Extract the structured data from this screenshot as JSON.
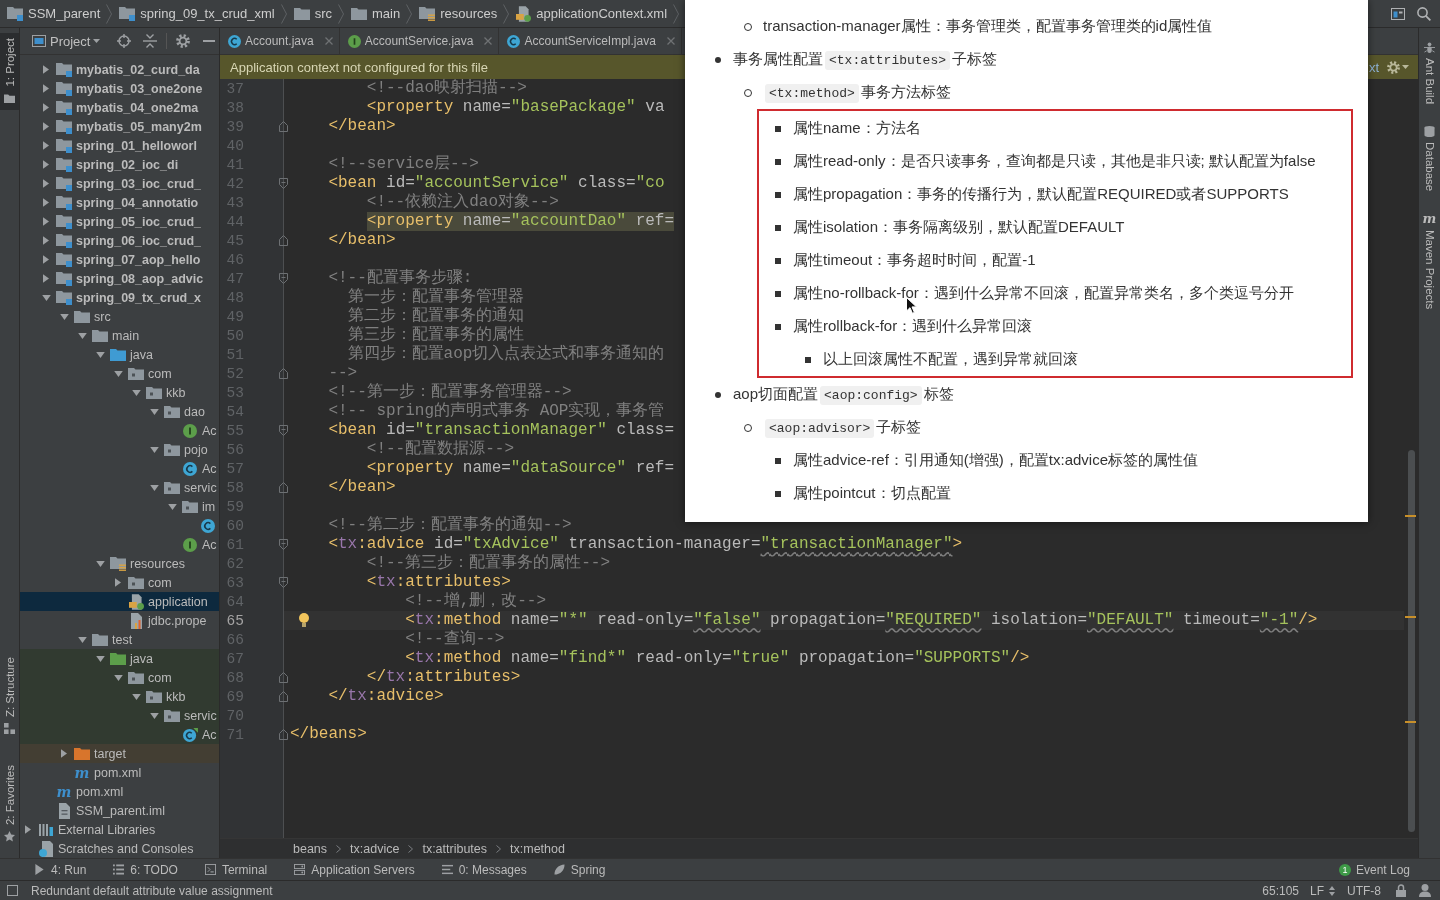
{
  "nav_bar": {
    "crumbs": [
      {
        "kind": "module",
        "label": "SSM_parent"
      },
      {
        "kind": "module",
        "label": "spring_09_tx_crud_xml"
      },
      {
        "kind": "folder",
        "label": "src"
      },
      {
        "kind": "folder",
        "label": "main"
      },
      {
        "kind": "resources-root",
        "label": "resources"
      },
      {
        "kind": "spring-xml",
        "label": "applicationContext.xml"
      }
    ]
  },
  "left_stripe": {
    "top": [
      {
        "kind": "project",
        "label": "1: Project",
        "selected": true
      }
    ],
    "bottom": [
      {
        "kind": "structure",
        "label": "Z: Structure",
        "selected": false
      },
      {
        "kind": "favorites",
        "label": "2: Favorites",
        "selected": false
      }
    ]
  },
  "project_panel": {
    "title": "Project",
    "tree": [
      {
        "kind": "module",
        "label": "mybatis_02_curd_da",
        "expanded": false,
        "selected": false
      },
      {
        "kind": "module",
        "label": "mybatis_03_one2one",
        "expanded": false,
        "selected": false
      },
      {
        "kind": "module",
        "label": "mybatis_04_one2ma",
        "expanded": false,
        "selected": false
      },
      {
        "kind": "module",
        "label": "mybatis_05_many2m",
        "expanded": false,
        "selected": false
      },
      {
        "kind": "module",
        "label": "spring_01_helloworl",
        "expanded": false,
        "selected": false
      },
      {
        "kind": "module",
        "label": "spring_02_ioc_di",
        "expanded": false,
        "selected": false
      },
      {
        "kind": "module",
        "label": "spring_03_ioc_crud_",
        "expanded": false,
        "selected": false
      },
      {
        "kind": "module",
        "label": "spring_04_annotatio",
        "expanded": false,
        "selected": false
      },
      {
        "kind": "module",
        "label": "spring_05_ioc_crud_",
        "expanded": false,
        "selected": false
      },
      {
        "kind": "module",
        "label": "spring_06_ioc_crud_",
        "expanded": false,
        "selected": false
      },
      {
        "kind": "module",
        "label": "spring_07_aop_hello",
        "expanded": false,
        "selected": false
      },
      {
        "kind": "module",
        "label": "spring_08_aop_advic",
        "expanded": false,
        "selected": false
      },
      {
        "kind": "module",
        "label": "spring_09_tx_crud_x",
        "expanded": true,
        "selected": false,
        "children": [
          {
            "kind": "folder",
            "label": "src",
            "expanded": true,
            "selected": false,
            "children": [
              {
                "kind": "folder",
                "label": "main",
                "expanded": true,
                "selected": false,
                "children": [
                  {
                    "kind": "source-root",
                    "label": "java",
                    "expanded": true,
                    "selected": false,
                    "children": [
                      {
                        "kind": "package",
                        "label": "com",
                        "expanded": true,
                        "selected": false,
                        "children": [
                          {
                            "kind": "package",
                            "label": "kkb",
                            "expanded": true,
                            "selected": false,
                            "children": [
                              {
                                "kind": "package",
                                "label": "dao",
                                "expanded": true,
                                "selected": false,
                                "children": [
                                  {
                                    "kind": "interface",
                                    "label": "Ac",
                                    "selected": false
                                  }
                                ]
                              },
                              {
                                "kind": "package",
                                "label": "pojo",
                                "expanded": true,
                                "selected": false,
                                "children": [
                                  {
                                    "kind": "class",
                                    "label": "Ac",
                                    "selected": false
                                  }
                                ]
                              },
                              {
                                "kind": "package",
                                "label": "servic",
                                "expanded": true,
                                "selected": false,
                                "children": [
                                  {
                                    "kind": "package",
                                    "label": "im",
                                    "expanded": true,
                                    "selected": false,
                                    "children": [
                                      {
                                        "kind": "class",
                                        "selected": false
                                      }
                                    ]
                                  },
                                  {
                                    "kind": "interface",
                                    "label": "Ac",
                                    "selected": false
                                  }
                                ]
                              }
                            ]
                          }
                        ]
                      }
                    ]
                  },
                  {
                    "kind": "resources-root",
                    "label": "resources",
                    "expanded": true,
                    "selected": false,
                    "children": [
                      {
                        "kind": "package",
                        "label": "com",
                        "expanded": false,
                        "selected": false
                      },
                      {
                        "kind": "spring-xml",
                        "label": "application",
                        "selected": true
                      },
                      {
                        "kind": "properties",
                        "label": "jdbc.prope",
                        "selected": false
                      }
                    ]
                  }
                ]
              },
              {
                "kind": "folder",
                "label": "test",
                "expanded": true,
                "selected": false,
                "children": [
                  {
                    "kind": "test-root",
                    "label": "java",
                    "expanded": true,
                    "selected": false,
                    "children": [
                      {
                        "kind": "package",
                        "label": "com",
                        "expanded": true,
                        "selected": false,
                        "children": [
                          {
                            "kind": "package",
                            "label": "kkb",
                            "expanded": true,
                            "selected": false,
                            "children": [
                              {
                                "kind": "package",
                                "label": "servic",
                                "expanded": true,
                                "selected": false,
                                "children": [
                                  {
                                    "kind": "test-class",
                                    "label": "Ac",
                                    "selected": false
                                  }
                                ]
                              }
                            ]
                          }
                        ]
                      }
                    ]
                  }
                ]
              }
            ]
          },
          {
            "kind": "excluded-folder",
            "label": "target",
            "expanded": false,
            "selected": false
          },
          {
            "kind": "maven-file",
            "icon_text": "m",
            "label": "pom.xml",
            "selected": false
          }
        ]
      },
      {
        "kind": "maven-file",
        "icon_text": "m",
        "label": "pom.xml",
        "selected": false
      },
      {
        "kind": "iml-file",
        "label": "SSM_parent.iml",
        "selected": false
      }
    ],
    "root_items": [
      {
        "kind": "libraries",
        "label": "External Libraries",
        "expanded": false,
        "selected": false
      },
      {
        "kind": "scratches",
        "label": "Scratches and Consoles",
        "selected": false
      }
    ]
  },
  "editor": {
    "tabs": [
      {
        "kind": "class",
        "label": "Account.java",
        "selected": false
      },
      {
        "kind": "interface",
        "label": "AccountService.java",
        "selected": false
      },
      {
        "kind": "class",
        "label": "AccountServiceImpl.java",
        "selected": false
      }
    ],
    "banner": {
      "message": "Application context not configured for this file",
      "link": "xt"
    },
    "lines": [
      {
        "no": "37",
        "kind": "plain",
        "tokens": [
          {
            "kind": "comment",
            "text": "        <!--dao映射扫描-->"
          }
        ],
        "current": false,
        "highlighted": false
      },
      {
        "no": "38",
        "kind": "plain",
        "tokens": [
          {
            "kind": "tag",
            "text": "        <property"
          },
          {
            "kind": "attr",
            "text": " name="
          },
          {
            "kind": "value",
            "text": "\"basePackage\""
          },
          {
            "kind": "attr",
            "text": " va"
          }
        ],
        "current": false,
        "highlighted": false
      },
      {
        "no": "39",
        "kind": "closer",
        "tokens": [
          {
            "kind": "tag",
            "text": "    </bean>"
          }
        ],
        "current": false,
        "highlighted": false
      },
      {
        "no": "40",
        "kind": "plain",
        "current": false
      },
      {
        "no": "41",
        "kind": "plain",
        "tokens": [
          {
            "kind": "comment",
            "text": "    <!--service层-->"
          }
        ],
        "current": false,
        "highlighted": false
      },
      {
        "no": "42",
        "kind": "opener",
        "tokens": [
          {
            "kind": "tag",
            "text": "    <bean"
          },
          {
            "kind": "attr",
            "text": " id="
          },
          {
            "kind": "value",
            "text": "\"accountService\""
          },
          {
            "kind": "attr",
            "text": " class="
          },
          {
            "kind": "value",
            "text": "\"co"
          }
        ],
        "current": false,
        "highlighted": false
      },
      {
        "no": "43",
        "kind": "plain",
        "tokens": [
          {
            "kind": "comment",
            "text": "        <!--依赖注入dao对象-->"
          }
        ],
        "current": false,
        "highlighted": false
      },
      {
        "no": "44",
        "kind": "plain",
        "tokens": [
          {
            "kind": "tag",
            "text": "        <property"
          },
          {
            "kind": "attr",
            "text": " name="
          },
          {
            "kind": "value",
            "text": "\"accountDao\""
          },
          {
            "kind": "attr",
            "text": " ref="
          }
        ],
        "current": false,
        "highlighted": true
      },
      {
        "no": "45",
        "kind": "closer",
        "tokens": [
          {
            "kind": "tag",
            "text": "    </bean>"
          }
        ],
        "current": false,
        "highlighted": false
      },
      {
        "no": "46",
        "kind": "plain",
        "current": false
      },
      {
        "no": "47",
        "kind": "opener",
        "tokens": [
          {
            "kind": "comment",
            "text": "    <!--配置事务步骤:"
          }
        ],
        "current": false,
        "highlighted": false
      },
      {
        "no": "48",
        "kind": "plain",
        "tokens": [
          {
            "kind": "comment",
            "text": "      第一步：配置事务管理器"
          }
        ],
        "current": false,
        "highlighted": false
      },
      {
        "no": "49",
        "kind": "plain",
        "tokens": [
          {
            "kind": "comment",
            "text": "      第二步：配置事务的通知"
          }
        ],
        "current": false,
        "highlighted": false
      },
      {
        "no": "50",
        "kind": "plain",
        "tokens": [
          {
            "kind": "comment",
            "text": "      第三步：配置事务的属性"
          }
        ],
        "current": false,
        "highlighted": false
      },
      {
        "no": "51",
        "kind": "plain",
        "tokens": [
          {
            "kind": "comment",
            "text": "      第四步：配置aop切入点表达式和事务通知的"
          }
        ],
        "current": false,
        "highlighted": false
      },
      {
        "no": "52",
        "kind": "closer",
        "tokens": [
          {
            "kind": "comment",
            "text": "    -->"
          }
        ],
        "current": false,
        "highlighted": false
      },
      {
        "no": "53",
        "kind": "plain",
        "tokens": [
          {
            "kind": "comment",
            "text": "    <!--第一步：配置事务管理器-->"
          }
        ],
        "current": false,
        "highlighted": false
      },
      {
        "no": "54",
        "kind": "plain",
        "tokens": [
          {
            "kind": "comment",
            "text": "    <!-- spring的声明式事务 AOP实现，事务管"
          }
        ],
        "current": false,
        "highlighted": false
      },
      {
        "no": "55",
        "kind": "opener",
        "tokens": [
          {
            "kind": "tag",
            "text": "    <bean"
          },
          {
            "kind": "attr",
            "text": " id="
          },
          {
            "kind": "value",
            "text": "\"transactionManager\""
          },
          {
            "kind": "attr",
            "text": " class="
          }
        ],
        "current": false,
        "highlighted": false
      },
      {
        "no": "56",
        "kind": "plain",
        "tokens": [
          {
            "kind": "comment",
            "text": "        <!--配置数据源-->"
          }
        ],
        "current": false,
        "highlighted": false
      },
      {
        "no": "57",
        "kind": "plain",
        "tokens": [
          {
            "kind": "tag",
            "text": "        <property"
          },
          {
            "kind": "attr",
            "text": " name="
          },
          {
            "kind": "value",
            "text": "\"dataSource\""
          },
          {
            "kind": "attr",
            "text": " ref="
          }
        ],
        "current": false,
        "highlighted": false
      },
      {
        "no": "58",
        "kind": "closer",
        "tokens": [
          {
            "kind": "tag",
            "text": "    </bean>"
          }
        ],
        "current": false,
        "highlighted": false
      },
      {
        "no": "59",
        "kind": "plain",
        "current": false
      },
      {
        "no": "60",
        "kind": "plain",
        "tokens": [
          {
            "kind": "comment",
            "text": "    <!--第二步：配置事务的通知-->"
          }
        ],
        "current": false,
        "highlighted": false
      },
      {
        "no": "61",
        "kind": "opener",
        "tokens": [
          {
            "kind": "tag",
            "text": "    <"
          },
          {
            "kind": "ns",
            "text": "tx"
          },
          {
            "kind": "tag",
            "text": ":advice"
          },
          {
            "kind": "attr",
            "text": " id="
          },
          {
            "kind": "value",
            "text": "\"txAdvice\""
          },
          {
            "kind": "attr",
            "text": " transaction-manager="
          },
          {
            "kind": "warned",
            "text": "\"transactionManager\""
          },
          {
            "kind": "tag",
            "text": ">"
          }
        ],
        "current": false,
        "highlighted": false
      },
      {
        "no": "62",
        "kind": "plain",
        "tokens": [
          {
            "kind": "comment",
            "text": "        <!--第三步：配置事务的属性-->"
          }
        ],
        "current": false,
        "highlighted": false
      },
      {
        "no": "63",
        "kind": "opener",
        "tokens": [
          {
            "kind": "tag",
            "text": "        <"
          },
          {
            "kind": "ns",
            "text": "tx"
          },
          {
            "kind": "tag",
            "text": ":attributes>"
          }
        ],
        "current": false,
        "highlighted": false
      },
      {
        "no": "64",
        "kind": "plain",
        "tokens": [
          {
            "kind": "comment",
            "text": "            <!--增,删，改-->"
          }
        ],
        "current": false,
        "highlighted": false
      },
      {
        "no": "65",
        "kind": "plain",
        "tokens": [
          {
            "kind": "tag",
            "text": "            <"
          },
          {
            "kind": "ns",
            "text": "tx"
          },
          {
            "kind": "tag",
            "text": ":method"
          },
          {
            "kind": "attr",
            "text": " name="
          },
          {
            "kind": "value",
            "text": "\"*\""
          },
          {
            "kind": "attr",
            "text": " read-only="
          },
          {
            "kind": "warned",
            "text": "\"false\""
          },
          {
            "kind": "attr",
            "text": " propagation="
          },
          {
            "kind": "warned",
            "text": "\"REQUIRED\""
          },
          {
            "kind": "attr",
            "text": " isolation="
          },
          {
            "kind": "warned",
            "text": "\"DEFAULT\""
          },
          {
            "kind": "attr",
            "text": " timeout="
          },
          {
            "kind": "warned",
            "text": "\"-1\""
          },
          {
            "kind": "tag",
            "text": "/>"
          }
        ],
        "current": true,
        "highlighted": false
      },
      {
        "no": "66",
        "kind": "plain",
        "tokens": [
          {
            "kind": "comment",
            "text": "            <!--查询-->"
          }
        ],
        "current": false,
        "highlighted": false
      },
      {
        "no": "67",
        "kind": "plain",
        "tokens": [
          {
            "kind": "tag",
            "text": "            <"
          },
          {
            "kind": "ns",
            "text": "tx"
          },
          {
            "kind": "tag",
            "text": ":method"
          },
          {
            "kind": "attr",
            "text": " name="
          },
          {
            "kind": "value",
            "text": "\"find*\""
          },
          {
            "kind": "attr",
            "text": " read-only="
          },
          {
            "kind": "value",
            "text": "\"true\""
          },
          {
            "kind": "attr",
            "text": " propagation="
          },
          {
            "kind": "value",
            "text": "\"SUPPORTS\""
          },
          {
            "kind": "tag",
            "text": "/>"
          }
        ],
        "current": false,
        "highlighted": false
      },
      {
        "no": "68",
        "kind": "closer",
        "tokens": [
          {
            "kind": "tag",
            "text": "        </"
          },
          {
            "kind": "ns",
            "text": "tx"
          },
          {
            "kind": "tag",
            "text": ":attributes>"
          }
        ],
        "current": false,
        "highlighted": false
      },
      {
        "no": "69",
        "kind": "closer",
        "tokens": [
          {
            "kind": "tag",
            "text": "    </"
          },
          {
            "kind": "ns",
            "text": "tx"
          },
          {
            "kind": "tag",
            "text": ":advice>"
          }
        ],
        "current": false,
        "highlighted": false
      },
      {
        "no": "70",
        "kind": "plain",
        "current": false
      },
      {
        "no": "71",
        "kind": "closer",
        "tokens": [
          {
            "kind": "tag",
            "text": "</beans>"
          }
        ],
        "current": false,
        "highlighted": false
      }
    ],
    "breadcrumbs": [
      "beans",
      "tx:advice",
      "tx:attributes",
      "tx:method"
    ]
  },
  "right_stripe": [
    {
      "kind": "ant",
      "label": "Ant Build",
      "selected": false
    },
    {
      "kind": "database",
      "label": "Database",
      "selected": false
    },
    {
      "kind": "maven",
      "icon_text": "m",
      "label": "Maven Projects",
      "selected": false
    }
  ],
  "tool_bar": {
    "buttons": [
      {
        "kind": "run",
        "label": "4: Run",
        "selected": false
      },
      {
        "kind": "todo",
        "label": "6: TODO",
        "selected": false
      },
      {
        "kind": "terminal",
        "label": "Terminal",
        "selected": false
      },
      {
        "kind": "servers",
        "label": "Application Servers",
        "selected": false
      },
      {
        "kind": "messages",
        "label": "0: Messages",
        "selected": false
      },
      {
        "kind": "spring",
        "label": "Spring",
        "selected": false
      }
    ],
    "event_log": {
      "count": "1",
      "label": "Event Log"
    }
  },
  "status_bar": {
    "message": "Redundant default attribute value assignment",
    "position": "65:105",
    "line_separator": "LF",
    "encoding": "UTF-8"
  },
  "document": {
    "continued": [
      {
        "parts": [
          {
            "kind": "text",
            "text": "transaction-manager属性：事务管理类，配置事务管理类的id属性值"
          }
        ],
        "boxed": false
      }
    ],
    "items": [
      {
        "parts": [
          {
            "kind": "text",
            "text": "事务属性配置"
          },
          {
            "kind": "code",
            "text": "<tx:attributes>"
          },
          {
            "kind": "text",
            "text": "子标签"
          }
        ],
        "boxed": false,
        "children": [
          {
            "parts": [
              {
                "kind": "code",
                "text": "<tx:method>"
              },
              {
                "kind": "text",
                "text": "事务方法标签"
              }
            ],
            "boxed": true,
            "children": [
              {
                "parts": [
                  {
                    "kind": "text",
                    "text": "属性name：方法名"
                  }
                ],
                "boxed": false
              },
              {
                "parts": [
                  {
                    "kind": "text",
                    "text": "属性read-only：是否只读事务，查询都是只读，其他是非只读; 默认配置为false"
                  }
                ],
                "boxed": false
              },
              {
                "parts": [
                  {
                    "kind": "text",
                    "text": "属性propagation：事务的传播行为，默认配置REQUIRED或者SUPPORTS"
                  }
                ],
                "boxed": false
              },
              {
                "parts": [
                  {
                    "kind": "text",
                    "text": "属性isolation：事务隔离级别，默认配置DEFAULT"
                  }
                ],
                "boxed": false
              },
              {
                "parts": [
                  {
                    "kind": "text",
                    "text": "属性timeout：事务超时时间，配置-1"
                  }
                ],
                "boxed": false
              },
              {
                "parts": [
                  {
                    "kind": "text",
                    "text": "属性no-rollback-for：遇到什么异常不回滚，配置异常类名，多个类逗号分开"
                  }
                ],
                "boxed": false
              },
              {
                "parts": [
                  {
                    "kind": "text",
                    "text": "属性rollback-for：遇到什么异常回滚"
                  }
                ],
                "boxed": false,
                "children": [
                  {
                    "parts": [
                      {
                        "kind": "text",
                        "text": "以上回滚属性不配置，遇到异常就回滚"
                      }
                    ],
                    "boxed": false
                  }
                ]
              }
            ]
          }
        ]
      },
      {
        "parts": [
          {
            "kind": "text",
            "text": "aop切面配置"
          },
          {
            "kind": "code",
            "text": "<aop:config>"
          },
          {
            "kind": "text",
            "text": "标签"
          }
        ],
        "boxed": false,
        "children": [
          {
            "parts": [
              {
                "kind": "code",
                "text": "<aop:advisor>"
              },
              {
                "kind": "text",
                "text": "子标签"
              }
            ],
            "boxed": false,
            "children": [
              {
                "parts": [
                  {
                    "kind": "text",
                    "text": "属性advice-ref：引用通知(增强)，配置tx:advice标签的属性值"
                  }
                ],
                "boxed": false
              },
              {
                "parts": [
                  {
                    "kind": "text",
                    "text": "属性pointcut：切点配置"
                  }
                ],
                "boxed": false
              }
            ]
          }
        ]
      }
    ]
  }
}
